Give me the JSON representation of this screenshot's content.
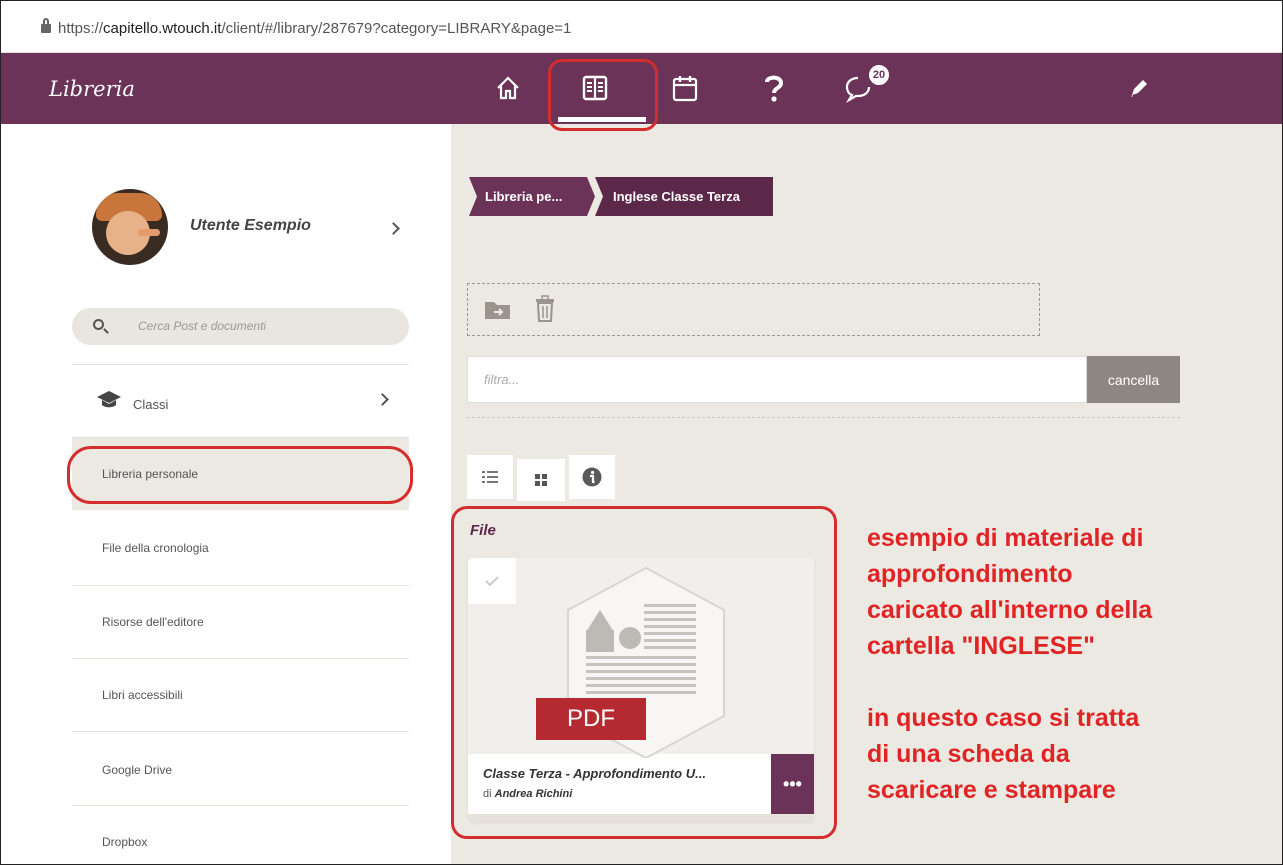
{
  "browser": {
    "url_prefix": "https://",
    "url_host": "capitello.wtouch.it",
    "url_path": "/client/#/library/287679?category=LIBRARY&page=1"
  },
  "header": {
    "title": "Libreria",
    "notification_count": "20"
  },
  "sidebar": {
    "user_name": "Utente Esempio",
    "search_placeholder": "Cerca Post e documenti",
    "classi_label": "Classi",
    "items": [
      {
        "label": "Libreria personale"
      },
      {
        "label": "File della cronologia"
      },
      {
        "label": "Risorse dell'editore"
      },
      {
        "label": "Libri accessibili"
      },
      {
        "label": "Google Drive"
      },
      {
        "label": "Dropbox"
      }
    ]
  },
  "main": {
    "breadcrumb": [
      "Libreria pe...",
      "Inglese Classe Terza"
    ],
    "filter_placeholder": "filtra...",
    "cancel_label": "cancella",
    "file_heading": "File",
    "card": {
      "badge": "PDF",
      "title": "Classe Terza - Approfondimento U...",
      "author_prefix": "di",
      "author": "Andrea Richini",
      "more": "•••"
    }
  },
  "annotations": {
    "lines": [
      "esempio di materiale di",
      "approfondimento",
      "caricato all'interno della",
      "cartella \"INGLESE\"",
      "",
      "in questo caso si tratta",
      "di una scheda da",
      "scaricare e stampare"
    ],
    "color": "#e02424"
  },
  "colors": {
    "brand": "#6b3358",
    "brand_dark": "#5c2849",
    "pdf_red": "#b52a30",
    "annotation_red": "#d42d2d"
  }
}
